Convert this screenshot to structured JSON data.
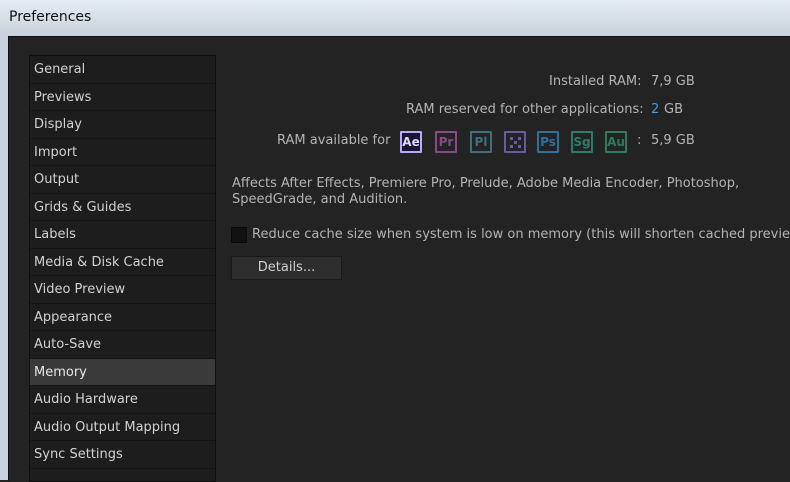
{
  "window": {
    "title": "Preferences"
  },
  "sidebar": {
    "items": [
      {
        "label": "General"
      },
      {
        "label": "Previews"
      },
      {
        "label": "Display"
      },
      {
        "label": "Import"
      },
      {
        "label": "Output"
      },
      {
        "label": "Grids & Guides"
      },
      {
        "label": "Labels"
      },
      {
        "label": "Media & Disk Cache"
      },
      {
        "label": "Video Preview"
      },
      {
        "label": "Appearance"
      },
      {
        "label": "Auto-Save"
      },
      {
        "label": "Memory"
      },
      {
        "label": "Audio Hardware"
      },
      {
        "label": "Audio Output Mapping"
      },
      {
        "label": "Sync Settings"
      }
    ],
    "selected": "Memory"
  },
  "memory": {
    "installed_label": "Installed RAM:",
    "installed_value": "7,9 GB",
    "reserved_label": "RAM reserved for other applications:",
    "reserved_value": "2",
    "reserved_unit": "GB",
    "available_label": "RAM available for",
    "available_colon": ":",
    "available_value": "5,9 GB",
    "apps": [
      {
        "abbr": "Ae",
        "color": "#9f8cff",
        "active": true
      },
      {
        "abbr": "Pr",
        "color": "#8a4a8a",
        "active": false
      },
      {
        "abbr": "Pl",
        "color": "#3f6f7a",
        "active": false
      },
      {
        "abbr": "",
        "color": "#6a5aa0",
        "active": false
      },
      {
        "abbr": "Ps",
        "color": "#2f6f9a",
        "active": false
      },
      {
        "abbr": "Sg",
        "color": "#2f7a6a",
        "active": false
      },
      {
        "abbr": "Au",
        "color": "#2f7a5a",
        "active": false
      }
    ],
    "description": "Affects After Effects, Premiere Pro, Prelude, Adobe Media Encoder, Photoshop, SpeedGrade, and Audition.",
    "reduce_cache_label": "Reduce cache size when system is low on memory (this will shorten cached preview)",
    "reduce_cache_checked": false,
    "details_button": "Details..."
  }
}
